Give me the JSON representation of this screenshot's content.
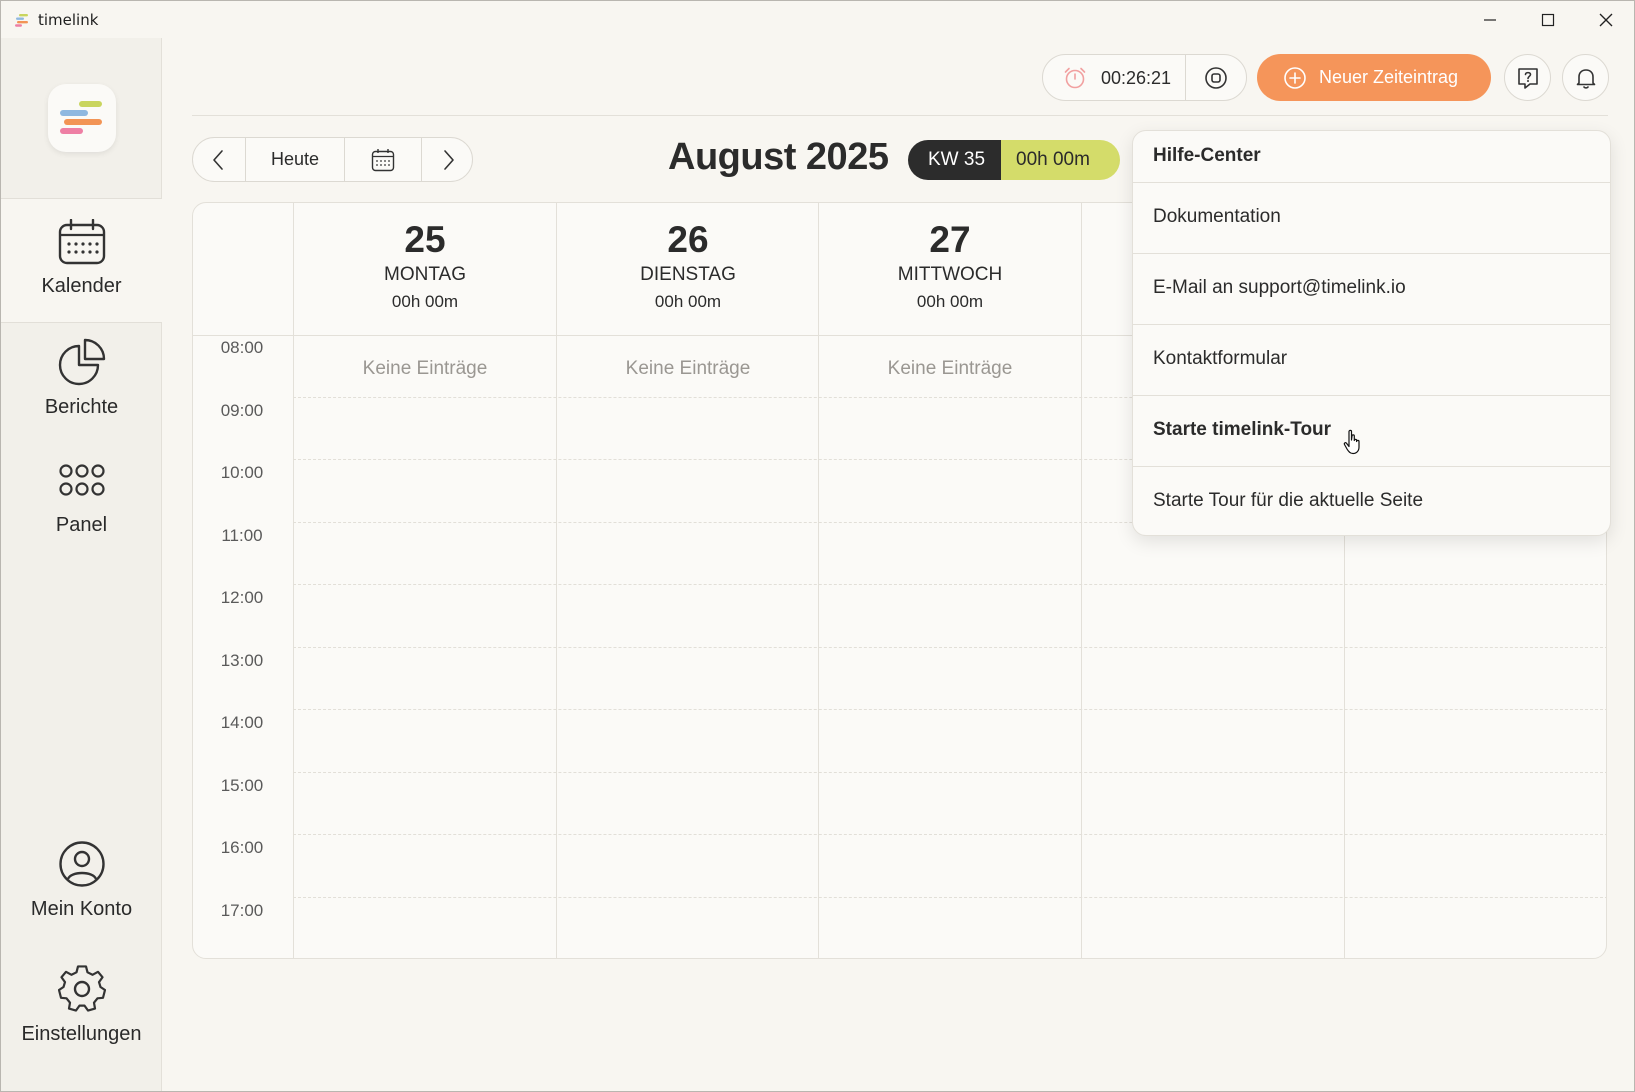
{
  "window": {
    "title": "timelink"
  },
  "sidebar": {
    "items": [
      {
        "label": "Kalender",
        "icon": "calendar-icon",
        "active": true
      },
      {
        "label": "Berichte",
        "icon": "pie-chart-icon",
        "active": false
      },
      {
        "label": "Panel",
        "icon": "grid-dots-icon",
        "active": false
      },
      {
        "label": "Mein Konto",
        "icon": "user-circle-icon",
        "active": false
      },
      {
        "label": "Einstellungen",
        "icon": "gear-icon",
        "active": false
      }
    ]
  },
  "toolbar": {
    "timer": "00:26:21",
    "new_entry_label": "Neuer Zeiteintrag",
    "colors": {
      "accent": "#f5955a",
      "week_hours": "#d4dc6a",
      "dark": "#2c2c2c"
    }
  },
  "calendar_nav": {
    "today_label": "Heute",
    "month_title": "August 2025",
    "week_label": "KW 35",
    "week_hours": "00h 00m"
  },
  "days": [
    {
      "num": "25",
      "name": "MONTAG",
      "hours": "00h 00m",
      "empty": "Keine Einträge"
    },
    {
      "num": "26",
      "name": "DIENSTAG",
      "hours": "00h 00m",
      "empty": "Keine Einträge"
    },
    {
      "num": "27",
      "name": "MITTWOCH",
      "hours": "00h 00m",
      "empty": "Keine Einträge"
    }
  ],
  "hours": [
    "08:00",
    "09:00",
    "10:00",
    "11:00",
    "12:00",
    "13:00",
    "14:00",
    "15:00",
    "16:00",
    "17:00"
  ],
  "help_menu": {
    "title": "Hilfe-Center",
    "items": [
      "Dokumentation",
      "E-Mail an support@timelink.io",
      "Kontaktformular",
      "Starte timelink-Tour",
      "Starte Tour für die aktuelle Seite"
    ]
  }
}
